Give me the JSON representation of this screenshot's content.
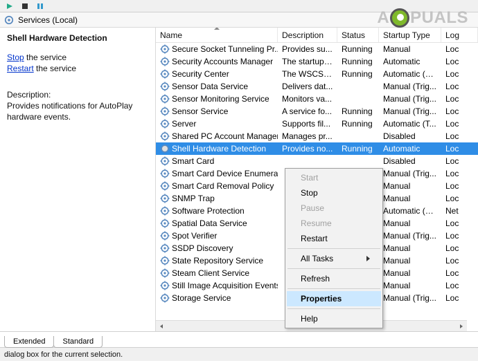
{
  "header": {
    "title": "Services (Local)"
  },
  "leftPanel": {
    "title": "Shell Hardware Detection",
    "stopPrefix": "Stop",
    "stopSuffix": " the service",
    "restartPrefix": "Restart",
    "restartSuffix": " the service",
    "descLabel": "Description:",
    "descText": "Provides notifications for AutoPlay hardware events."
  },
  "columns": {
    "name": "Name",
    "desc": "Description",
    "status": "Status",
    "startup": "Startup Type",
    "log": "Log"
  },
  "services": [
    {
      "name": "Secure Socket Tunneling Pr...",
      "desc": "Provides su...",
      "status": "Running",
      "startup": "Manual",
      "log": "Loc"
    },
    {
      "name": "Security Accounts Manager",
      "desc": "The startup ...",
      "status": "Running",
      "startup": "Automatic",
      "log": "Loc"
    },
    {
      "name": "Security Center",
      "desc": "The WSCSV...",
      "status": "Running",
      "startup": "Automatic (D...",
      "log": "Loc"
    },
    {
      "name": "Sensor Data Service",
      "desc": "Delivers dat...",
      "status": "",
      "startup": "Manual (Trig...",
      "log": "Loc"
    },
    {
      "name": "Sensor Monitoring Service",
      "desc": "Monitors va...",
      "status": "",
      "startup": "Manual (Trig...",
      "log": "Loc"
    },
    {
      "name": "Sensor Service",
      "desc": "A service fo...",
      "status": "Running",
      "startup": "Manual (Trig...",
      "log": "Loc"
    },
    {
      "name": "Server",
      "desc": "Supports fil...",
      "status": "Running",
      "startup": "Automatic (T...",
      "log": "Loc"
    },
    {
      "name": "Shared PC Account Manager",
      "desc": "Manages pr...",
      "status": "",
      "startup": "Disabled",
      "log": "Loc"
    },
    {
      "name": "Shell Hardware Detection",
      "desc": "Provides no...",
      "status": "Running",
      "startup": "Automatic",
      "log": "Loc",
      "selected": true
    },
    {
      "name": "Smart Card",
      "desc": "",
      "status": "",
      "startup": "Disabled",
      "log": "Loc"
    },
    {
      "name": "Smart Card Device Enumera...",
      "desc": "",
      "status": "",
      "startup": "Manual (Trig...",
      "log": "Loc"
    },
    {
      "name": "Smart Card Removal Policy",
      "desc": "",
      "status": "",
      "startup": "Manual",
      "log": "Loc"
    },
    {
      "name": "SNMP Trap",
      "desc": "",
      "status": "",
      "startup": "Manual",
      "log": "Loc"
    },
    {
      "name": "Software Protection",
      "desc": "",
      "status": "",
      "startup": "Automatic (D...",
      "log": "Net"
    },
    {
      "name": "Spatial Data Service",
      "desc": "",
      "status": "",
      "startup": "Manual",
      "log": "Loc"
    },
    {
      "name": "Spot Verifier",
      "desc": "",
      "status": "",
      "startup": "Manual (Trig...",
      "log": "Loc"
    },
    {
      "name": "SSDP Discovery",
      "desc": "",
      "status": "",
      "startup": "Manual",
      "log": "Loc"
    },
    {
      "name": "State Repository Service",
      "desc": "",
      "status": "",
      "startup": "Manual",
      "log": "Loc"
    },
    {
      "name": "Steam Client Service",
      "desc": "",
      "status": "",
      "startup": "Manual",
      "log": "Loc"
    },
    {
      "name": "Still Image Acquisition Events",
      "desc": "",
      "status": "",
      "startup": "Manual",
      "log": "Loc"
    },
    {
      "name": "Storage Service",
      "desc": "",
      "status": "",
      "startup": "Manual (Trig...",
      "log": "Loc"
    }
  ],
  "contextMenu": {
    "start": "Start",
    "stop": "Stop",
    "pause": "Pause",
    "resume": "Resume",
    "restart": "Restart",
    "allTasks": "All Tasks",
    "refresh": "Refresh",
    "properties": "Properties",
    "help": "Help"
  },
  "tabs": {
    "extended": "Extended",
    "standard": "Standard"
  },
  "statusbar": "dialog box for the current selection.",
  "watermark": {
    "pre": "A",
    "post": "PUALS"
  }
}
